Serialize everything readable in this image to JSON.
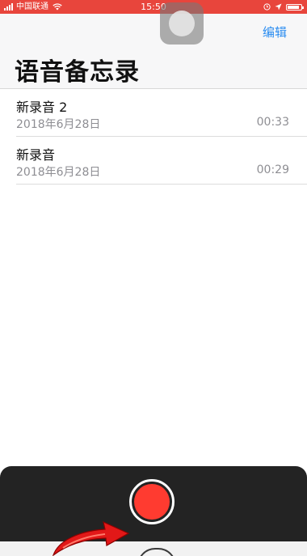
{
  "status_bar": {
    "carrier": "中国联通",
    "time": "15:50",
    "battery_level": 0.85
  },
  "header": {
    "edit_label": "编辑",
    "title": "语音备忘录"
  },
  "recordings": [
    {
      "title": "新录音 2",
      "date": "2018年6月28日",
      "duration": "00:33"
    },
    {
      "title": "新录音",
      "date": "2018年6月28日",
      "duration": "00:29"
    }
  ],
  "colors": {
    "status_bar": "#e8453c",
    "accent": "#2a8cf0",
    "record": "#ff3b30",
    "panel": "#232323"
  },
  "icons": {
    "signal": "signal-icon",
    "wifi": "wifi-icon",
    "battery": "battery-icon",
    "location": "location-icon",
    "alarm": "alarm-icon",
    "record": "record-icon"
  }
}
